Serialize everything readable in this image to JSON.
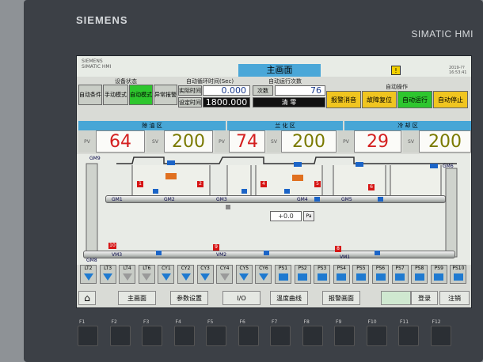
{
  "bezel": {
    "brand": "SIEMENS",
    "model": "SIMATIC HMI"
  },
  "header": {
    "logo_line1": "SIEMENS",
    "logo_line2": "SIMATIC HMI",
    "title": "主画面",
    "date": "2019-??",
    "time": "16:53:41"
  },
  "status": {
    "label": "设备状态",
    "buttons": [
      "自动条件",
      "手动模式",
      "自动模式",
      "异常报警"
    ]
  },
  "cycle": {
    "label": "自动循环时间(Sec)",
    "actual_label": "实际时间",
    "actual_value": "0.000",
    "set_label": "设定时间",
    "set_value": "1800.000"
  },
  "runs": {
    "label": "自动运行次数",
    "count_label": "次数",
    "count_value": "76",
    "clear_label": "清 零"
  },
  "auto": {
    "label": "自动操作",
    "buttons": [
      "报警消音",
      "故障复位",
      "自动运行",
      "自动停止"
    ]
  },
  "zones": [
    {
      "name": "除 油 区",
      "pv": "64",
      "sv": "200"
    },
    {
      "name": "兰 化 区",
      "pv": "74",
      "sv": "200"
    },
    {
      "name": "冷 却 区",
      "pv": "29",
      "sv": "200"
    }
  ],
  "tags": {
    "pv": "PV",
    "sv": "SV"
  },
  "process": {
    "gm_upper": [
      "GM1",
      "GM2",
      "GM3",
      "GM4",
      "GM5"
    ],
    "gm_side": [
      "GM9",
      "GM6"
    ],
    "vm": [
      "VM3",
      "VM2",
      "VM1"
    ],
    "gm_bottom": "GM8",
    "pressure_value": "+0.0",
    "pressure_unit": "Pa",
    "markers": [
      "1",
      "2",
      "3",
      "4",
      "5",
      "6",
      "7",
      "9",
      "8",
      "10"
    ]
  },
  "signals": [
    "LT2",
    "LT3",
    "LT4",
    "LT6",
    "CY1",
    "CY2",
    "CY3",
    "CY4",
    "CY5",
    "CY6",
    "PS1",
    "PS2",
    "PS3",
    "PS4",
    "PS5",
    "PS6",
    "PS7",
    "PS8",
    "PS9",
    "PS10"
  ],
  "nav": {
    "home": "⌂",
    "main": "主画面",
    "params": "参数设置",
    "io": "I/O",
    "temp": "温度曲线",
    "alarm": "报警画面",
    "login": "登录",
    "logout": "注销"
  },
  "fkeys": [
    "F1",
    "F2",
    "F3",
    "F4",
    "F5",
    "F6",
    "F7",
    "F8",
    "F9",
    "F10",
    "F11",
    "F12"
  ],
  "colors": {
    "accent": "#4aa7d8",
    "pv_text": "#d42020",
    "sv_text": "#7a7a00",
    "active": "#2ec62e",
    "warn": "#f0c520"
  }
}
